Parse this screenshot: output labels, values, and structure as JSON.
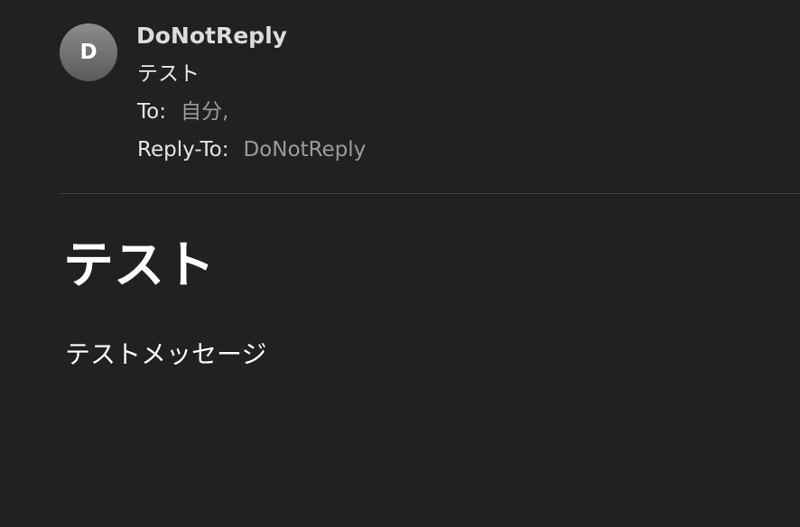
{
  "header": {
    "avatar_letter": "D",
    "sender_name": "DoNotReply",
    "subject": "テスト",
    "to_label": "To:",
    "to_value": "自分,",
    "reply_to_label": "Reply-To:",
    "reply_to_value": "DoNotReply"
  },
  "message": {
    "title": "テスト",
    "body": "テストメッセージ"
  },
  "colors": {
    "background": "#222120",
    "text_primary": "#ffffff",
    "text_secondary": "#9c9c9c",
    "divider": "#3f3e3d"
  }
}
